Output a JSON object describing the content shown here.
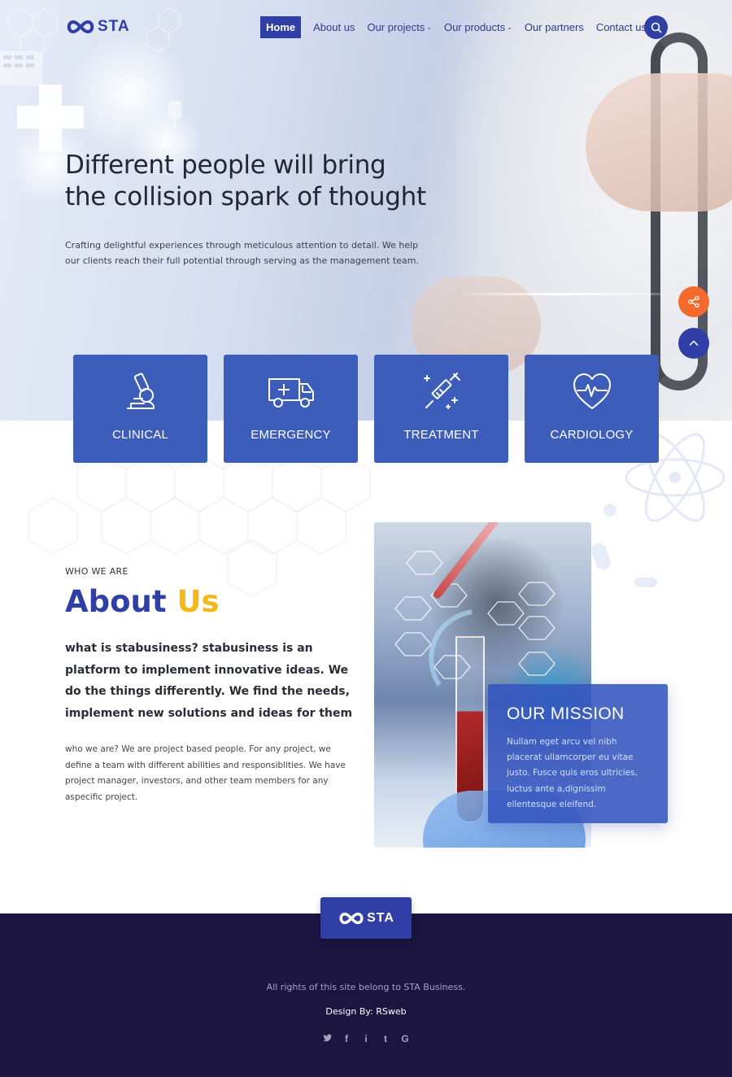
{
  "brand": {
    "logo_text": "STA",
    "primary": "#2f3fa5",
    "accent": "#f4b81a",
    "orange": "#f36a2c",
    "footer_bg": "#1c1540"
  },
  "nav": {
    "items": [
      {
        "label": "Home",
        "active": true
      },
      {
        "label": "About us"
      },
      {
        "label": "Our projects",
        "dropdown": true
      },
      {
        "label": "Our products",
        "dropdown": true
      },
      {
        "label": "Our partners"
      },
      {
        "label": "Contact us"
      }
    ],
    "search_icon": "search-icon"
  },
  "hero": {
    "title_line1": "Different people will bring",
    "title_line2": "the collision spark of thought",
    "description": "Crafting delightful experiences through meticulous attention to detail. We help our clients reach their full potential through serving as the management team."
  },
  "floating": {
    "share_icon": "share-icon",
    "up_icon": "arrow-up-icon"
  },
  "services": [
    {
      "label": "CLINICAL",
      "icon": "microscope-icon"
    },
    {
      "label": "EMERGENCY",
      "icon": "ambulance-icon"
    },
    {
      "label": "TREATMENT",
      "icon": "syringe-icon"
    },
    {
      "label": "CARDIOLOGY",
      "icon": "heart-pulse-icon"
    }
  ],
  "about": {
    "eyebrow": "WHO WE ARE",
    "title_main": "About",
    "title_accent": "Us",
    "lead": "what is stabusiness? stabusiness is an platform to implement innovative ideas. We do the things differently. We find the needs, implement new solutions and ideas for them",
    "body": "who we are? We are project based people. For any project, we define a team with different abilities and responsiblities. We have project manager, investors, and other team members for any aspecific project."
  },
  "mission": {
    "title": "OUR MISSION",
    "text": "Nullam eget arcu vel nibh placerat ullamcorper eu vitae justo. Fusce quis eros ultricies, luctus ante a,dignissim ellentesque eleifend."
  },
  "footer": {
    "copyright": "All rights of this site belong to STA Business.",
    "credit": "Design By: RSweb",
    "socials": [
      {
        "icon": "twitter-icon",
        "glyph": "🐦"
      },
      {
        "icon": "facebook-icon",
        "glyph": "f"
      },
      {
        "icon": "instagram-icon",
        "glyph": "i"
      },
      {
        "icon": "tumblr-icon",
        "glyph": "t"
      },
      {
        "icon": "google-icon",
        "glyph": "G"
      }
    ]
  }
}
